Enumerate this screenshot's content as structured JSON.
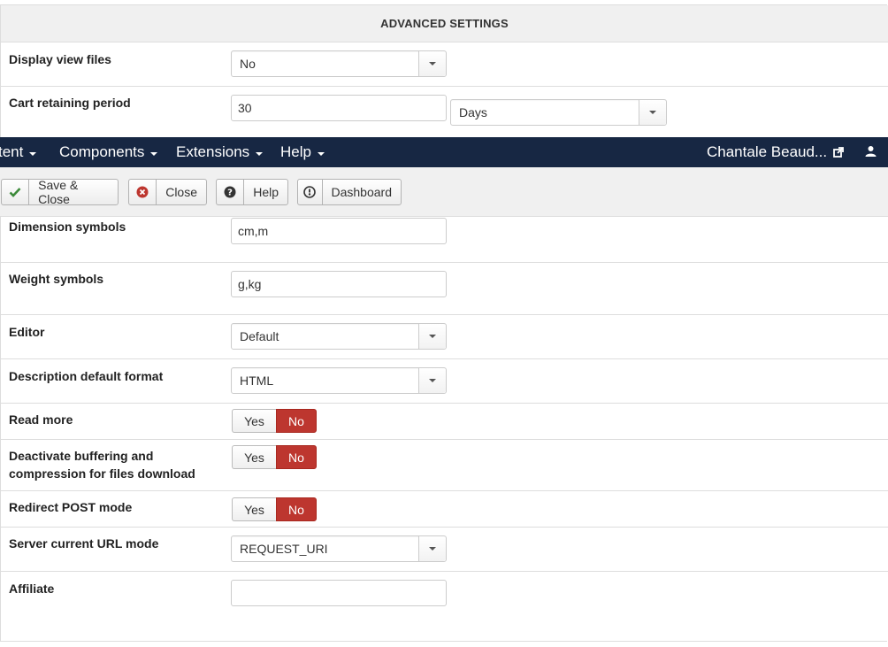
{
  "advanced": {
    "title": "ADVANCED SETTINGS",
    "display_view_files": {
      "label": "Display view files",
      "value": "No"
    },
    "cart_retaining": {
      "label": "Cart retaining period",
      "value": "30",
      "unit": "Days"
    }
  },
  "nav": {
    "items": [
      "tent",
      "Components",
      "Extensions",
      "Help"
    ],
    "user": "Chantale Beaud..."
  },
  "toolbar": {
    "save_close": "Save & Close",
    "close": "Close",
    "help": "Help",
    "dashboard": "Dashboard"
  },
  "settings": {
    "dimension": {
      "label": "Dimension symbols",
      "value": "cm,m"
    },
    "weight": {
      "label": "Weight symbols",
      "value": "g,kg"
    },
    "editor": {
      "label": "Editor",
      "value": "Default"
    },
    "description_format": {
      "label": "Description default format",
      "value": "HTML"
    },
    "read_more": {
      "label": "Read more",
      "yes": "Yes",
      "no": "No",
      "selected": "No"
    },
    "deactivate_buffering": {
      "label_line1": "Deactivate buffering and",
      "label_line2": "compression for files download",
      "yes": "Yes",
      "no": "No",
      "selected": "No"
    },
    "redirect_post": {
      "label": "Redirect POST mode",
      "yes": "Yes",
      "no": "No",
      "selected": "No"
    },
    "server_url_mode": {
      "label": "Server current URL mode",
      "value": "REQUEST_URI"
    },
    "affiliate": {
      "label": "Affiliate",
      "value": ""
    }
  },
  "colors": {
    "navbar": "#172743",
    "toggle_no_active": "#bd362f",
    "save_icon": "#3c8a3a",
    "close_icon": "#bd362f"
  }
}
